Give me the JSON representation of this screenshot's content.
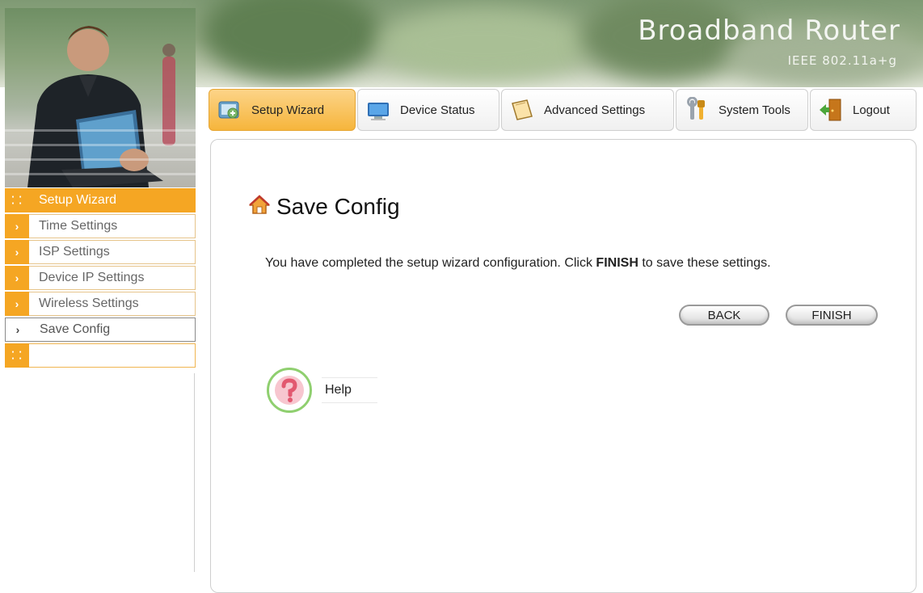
{
  "header": {
    "brand_title": "Broadband Router",
    "brand_subtitle": "IEEE 802.11a+g"
  },
  "tabs": [
    {
      "label": "Setup Wizard",
      "icon": "setup-wizard-icon",
      "active": true
    },
    {
      "label": "Device Status",
      "icon": "monitor-icon",
      "active": false
    },
    {
      "label": "Advanced Settings",
      "icon": "notepad-icon",
      "active": false
    },
    {
      "label": "System Tools",
      "icon": "tools-icon",
      "active": false
    },
    {
      "label": "Logout",
      "icon": "door-exit-icon",
      "active": false
    }
  ],
  "sidebar": {
    "header_label": "Setup Wizard",
    "items": [
      {
        "label": "Time Settings",
        "icon": "chevron-right-icon"
      },
      {
        "label": "ISP Settings",
        "icon": "chevron-right-icon"
      },
      {
        "label": "Device IP Settings",
        "icon": "chevron-right-icon"
      },
      {
        "label": "Wireless Settings",
        "icon": "chevron-right-icon"
      },
      {
        "label": "Save Config",
        "icon": "chevron-right-icon",
        "current": true
      }
    ]
  },
  "main": {
    "title": "Save Config",
    "message_before": "You have completed the setup wizard configuration. Click ",
    "message_bold": "FINISH",
    "message_after": " to save these settings.",
    "back_label": "BACK",
    "finish_label": "FINISH",
    "help_label": "Help"
  },
  "colors": {
    "accent": "#f5a623",
    "help_ring": "#8fcf6f"
  }
}
